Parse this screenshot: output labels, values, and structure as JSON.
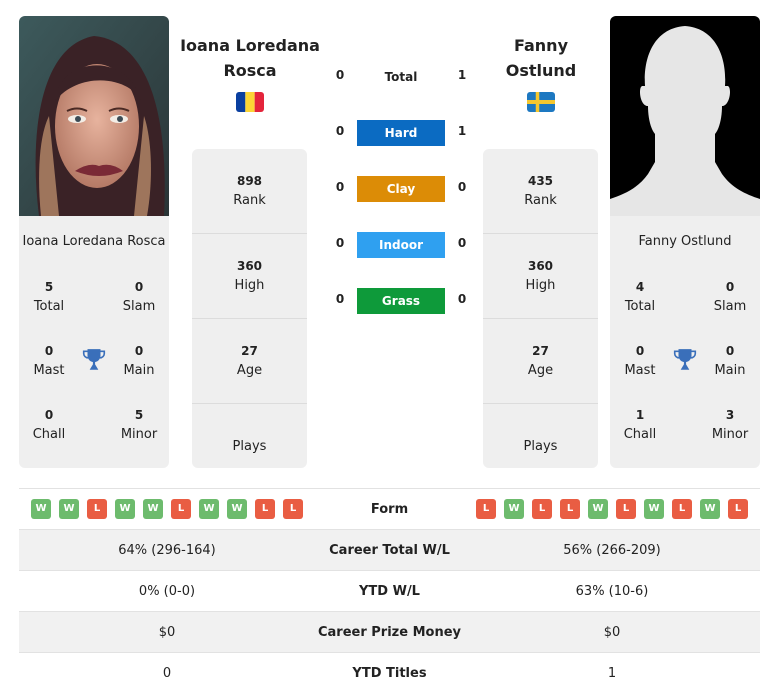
{
  "colors": {
    "hard": "#0b6bc2",
    "clay": "#dc8c06",
    "indoor": "#2fa0f0",
    "grass": "#0e9a3a",
    "win": "#6dbb6d",
    "loss": "#e95d43",
    "trophy": "#3a6fba"
  },
  "player1": {
    "name": "Ioana Loredana Rosca",
    "name_line1": "Ioana Loredana",
    "name_line2": "Rosca",
    "flag": "Romania",
    "photo": "player-photo",
    "titles": {
      "total": "5",
      "total_label": "Total",
      "slam": "0",
      "slam_label": "Slam",
      "mast": "0",
      "mast_label": "Mast",
      "main": "0",
      "main_label": "Main",
      "chall": "0",
      "chall_label": "Chall",
      "minor": "5",
      "minor_label": "Minor"
    },
    "stats": {
      "rank": "898",
      "rank_label": "Rank",
      "high": "360",
      "high_label": "High",
      "age": "27",
      "age_label": "Age",
      "plays_label": "Plays"
    },
    "form": [
      "W",
      "W",
      "L",
      "W",
      "W",
      "L",
      "W",
      "W",
      "L",
      "L"
    ],
    "career_wl": "64% (296-164)",
    "ytd_wl": "0% (0-0)",
    "prize_money": "$0",
    "ytd_titles": "0"
  },
  "player2": {
    "name": "Fanny Ostlund",
    "name_line1": "Fanny",
    "name_line2": "Ostlund",
    "flag": "Sweden",
    "photo": "silhouette-placeholder",
    "titles": {
      "total": "4",
      "total_label": "Total",
      "slam": "0",
      "slam_label": "Slam",
      "mast": "0",
      "mast_label": "Mast",
      "main": "0",
      "main_label": "Main",
      "chall": "1",
      "chall_label": "Chall",
      "minor": "3",
      "minor_label": "Minor"
    },
    "stats": {
      "rank": "435",
      "rank_label": "Rank",
      "high": "360",
      "high_label": "High",
      "age": "27",
      "age_label": "Age",
      "plays_label": "Plays"
    },
    "form": [
      "L",
      "W",
      "L",
      "L",
      "W",
      "L",
      "W",
      "L",
      "W",
      "L"
    ],
    "career_wl": "56% (266-209)",
    "ytd_wl": "63% (10-6)",
    "prize_money": "$0",
    "ytd_titles": "1"
  },
  "h2h": {
    "total": {
      "label": "Total",
      "p1": "0",
      "p2": "1"
    },
    "hard": {
      "label": "Hard",
      "p1": "0",
      "p2": "1"
    },
    "clay": {
      "label": "Clay",
      "p1": "0",
      "p2": "0"
    },
    "indoor": {
      "label": "Indoor",
      "p1": "0",
      "p2": "0"
    },
    "grass": {
      "label": "Grass",
      "p1": "0",
      "p2": "0"
    }
  },
  "table": {
    "form_label": "Form",
    "career_wl_label": "Career Total W/L",
    "ytd_wl_label": "YTD W/L",
    "prize_label": "Career Prize Money",
    "ytd_titles_label": "YTD Titles"
  }
}
